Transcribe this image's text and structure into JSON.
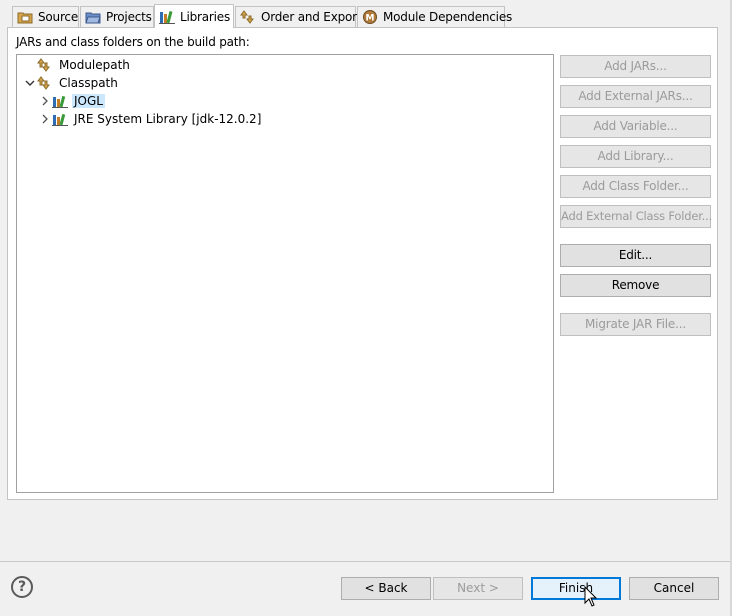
{
  "tabs": [
    {
      "label": "Source",
      "icon": "source-folder-icon",
      "active": false
    },
    {
      "label": "Projects",
      "icon": "projects-folder-icon",
      "active": false
    },
    {
      "label": "Libraries",
      "icon": "libraries-icon",
      "active": true
    },
    {
      "label": "Order and Export",
      "icon": "order-export-icon",
      "active": false
    },
    {
      "label": "Module Dependencies",
      "icon": "module-icon",
      "active": false
    }
  ],
  "panel": {
    "heading": "JARs and class folders on the build path:"
  },
  "tree": {
    "nodes": [
      {
        "label": "Modulepath",
        "icon": "modulepath-icon",
        "level": 0,
        "expander": "none"
      },
      {
        "label": "Classpath",
        "icon": "classpath-icon",
        "level": 0,
        "expander": "expanded"
      },
      {
        "label": "JOGL",
        "icon": "library-icon",
        "level": 1,
        "expander": "collapsed",
        "selected": true
      },
      {
        "label": "JRE System Library [jdk-12.0.2]",
        "icon": "library-icon",
        "level": 1,
        "expander": "collapsed"
      }
    ]
  },
  "side_buttons": {
    "add_jars": "Add JARs...",
    "add_external_jars": "Add External JARs...",
    "add_variable": "Add Variable...",
    "add_library": "Add Library...",
    "add_class_folder": "Add Class Folder...",
    "add_external_class_folder": "Add External Class Folder...",
    "edit": "Edit...",
    "remove": "Remove",
    "migrate_jar": "Migrate JAR File..."
  },
  "footer": {
    "help": "?",
    "back": "< Back",
    "next": "Next >",
    "finish": "Finish",
    "cancel": "Cancel"
  },
  "colors": {
    "selection": "#cce8ff",
    "default_button_border": "#0078d7"
  }
}
